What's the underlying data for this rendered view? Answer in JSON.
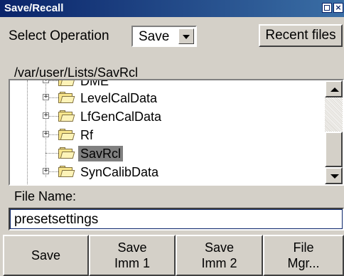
{
  "window": {
    "title": "Save/Recall",
    "close_glyph": "×"
  },
  "operation": {
    "label": "Select Operation",
    "value": "Save"
  },
  "recent_button": "Recent files",
  "path": "/var/user/Lists/SavRcl",
  "tree": {
    "items": [
      {
        "label": "DME",
        "expandable": true,
        "selected": false
      },
      {
        "label": "LevelCalData",
        "expandable": true,
        "selected": false
      },
      {
        "label": "LfGenCalData",
        "expandable": true,
        "selected": false
      },
      {
        "label": "Rf",
        "expandable": true,
        "selected": false
      },
      {
        "label": "SavRcl",
        "expandable": false,
        "selected": true
      },
      {
        "label": "SynCalibData",
        "expandable": true,
        "selected": false
      }
    ],
    "expander_glyph": "+"
  },
  "file_name": {
    "label": "File Name:",
    "value": "presetsettings"
  },
  "buttons": {
    "save": "Save",
    "save_imm1_l1": "Save",
    "save_imm1_l2": "Imm 1",
    "save_imm2_l1": "Save",
    "save_imm2_l2": "Imm 2",
    "file_mgr_l1": "File",
    "file_mgr_l2": "Mgr..."
  },
  "icons": {
    "folder": "folder-icon",
    "scroll_up": "arrow-up-icon",
    "scroll_down": "arrow-down-icon"
  }
}
